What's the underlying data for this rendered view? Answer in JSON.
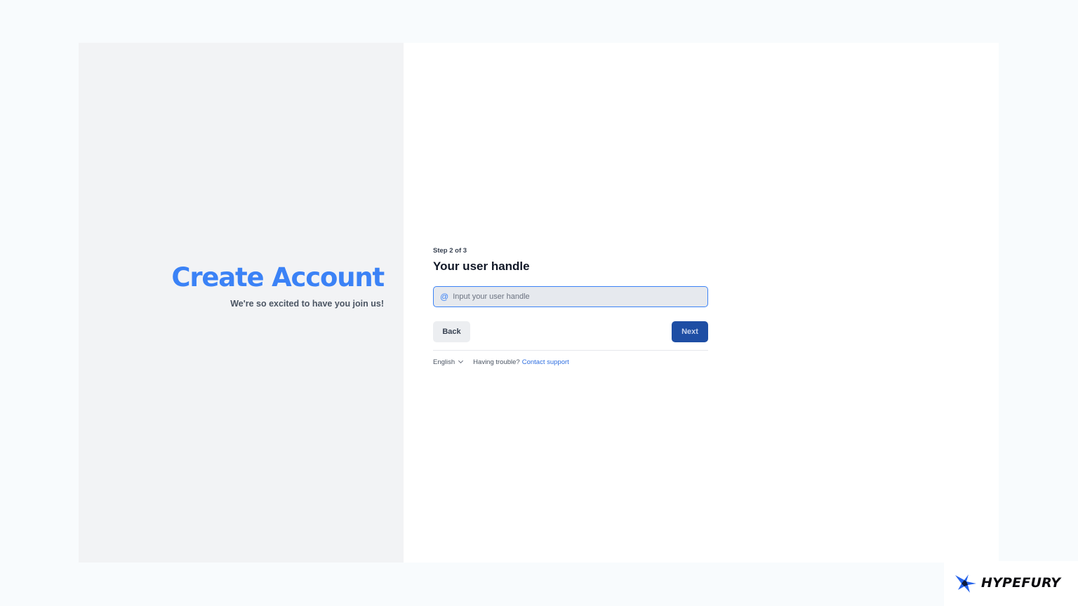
{
  "hero": {
    "title": "Create Account",
    "subtitle": "We're so excited to have you join us!"
  },
  "form": {
    "step": "Step 2 of 3",
    "title": "Your user handle",
    "input_icon": "at-sign-icon",
    "input_prefix": "@",
    "input_placeholder": "Input your user handle",
    "input_value": "",
    "back_label": "Back",
    "next_label": "Next"
  },
  "footer": {
    "language": "English",
    "trouble_text": "Having trouble?",
    "support_link": "Contact support"
  },
  "brand": {
    "name": "HYPEFURY",
    "logo_icon": "bird-logo-icon"
  },
  "colors": {
    "accent": "#3b82f6",
    "primary_button": "#1e4ea4",
    "link": "#2f6fe0",
    "left_panel_bg": "#f2f3f5",
    "page_bg": "#f8fbfd"
  }
}
